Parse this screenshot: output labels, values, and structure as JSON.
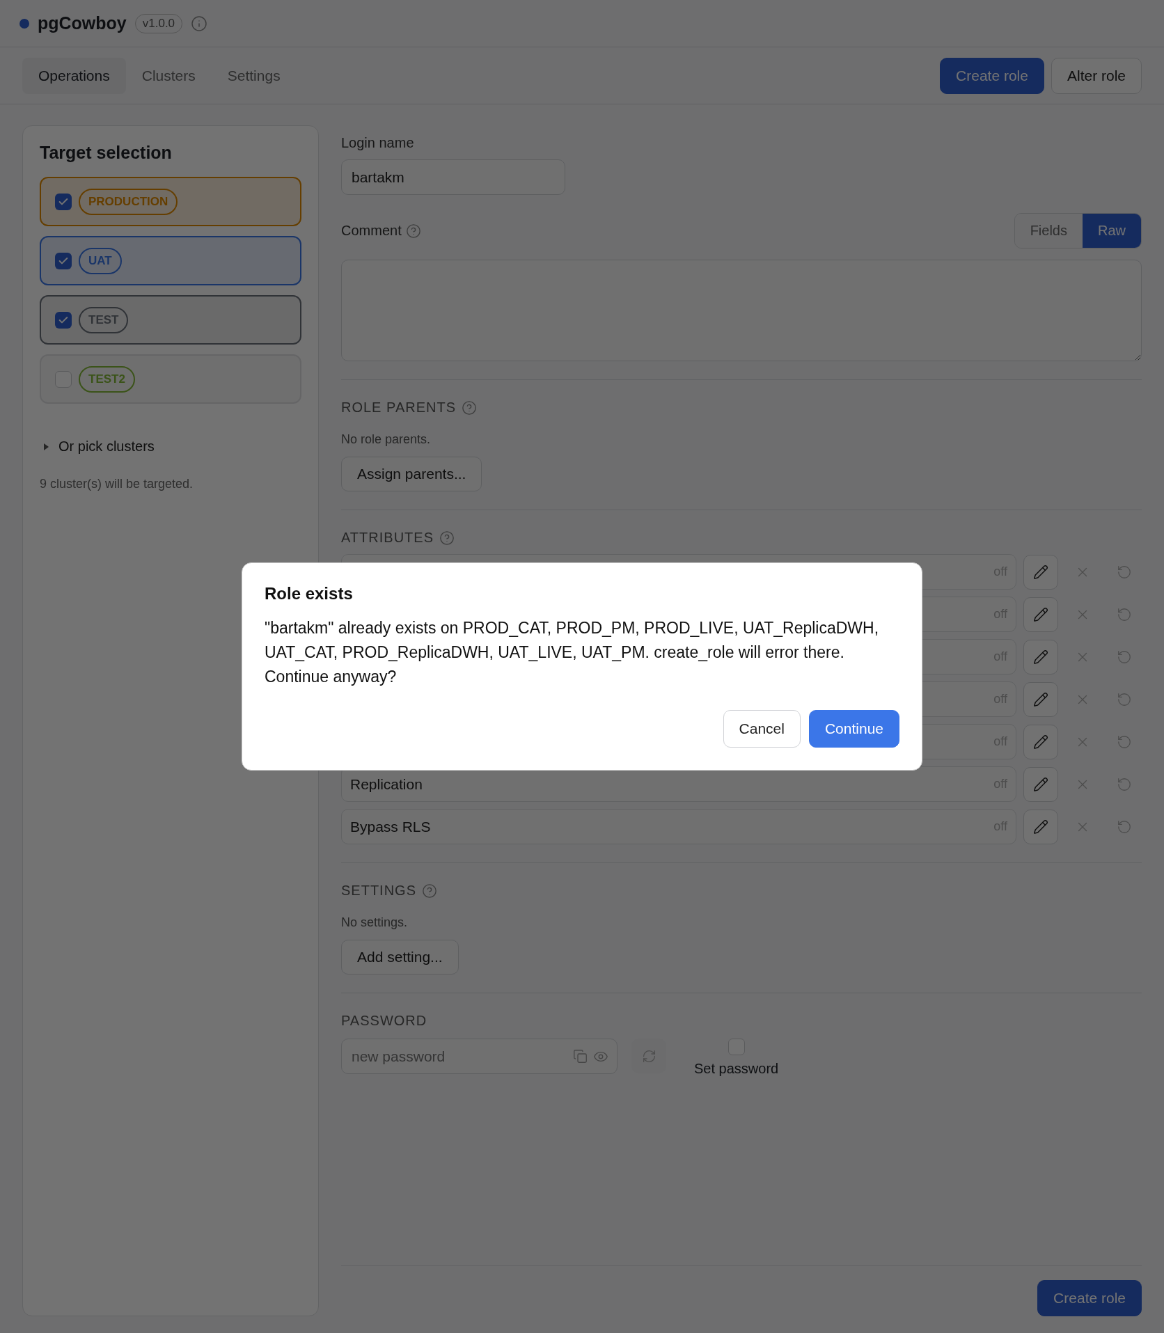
{
  "app": {
    "name": "pgCowboy",
    "version": "v1.0.0"
  },
  "nav_tabs": [
    {
      "label": "Operations",
      "selected": true
    },
    {
      "label": "Clusters",
      "selected": false
    },
    {
      "label": "Settings",
      "selected": false
    }
  ],
  "header_actions": [
    {
      "label": "Create role",
      "kind": "primary"
    },
    {
      "label": "Alter role",
      "kind": "secondary"
    }
  ],
  "target_selection": {
    "title": "Target selection",
    "environments": [
      {
        "label": "PRODUCTION",
        "checked": true,
        "color": "#653e00"
      },
      {
        "label": "UAT",
        "checked": true,
        "color": "#1a3568"
      },
      {
        "label": "TEST",
        "checked": true,
        "color": "#303337"
      },
      {
        "label": "TEST2",
        "checked": false,
        "color": "#3b5319"
      }
    ],
    "pick_clusters": {
      "label": "Or pick clusters",
      "expanded": false
    },
    "summary": "9 cluster(s) will be targeted."
  },
  "form": {
    "login_name": {
      "label": "Login name",
      "value": "bartakm"
    },
    "comment": {
      "label": "Comment",
      "modes": [
        {
          "label": "Fields",
          "selected": false
        },
        {
          "label": "Raw",
          "selected": true
        }
      ]
    },
    "role_parents": {
      "heading": "ROLE PARENTS",
      "empty_text": "No role parents.",
      "button": "Assign parents..."
    },
    "attributes": {
      "heading": "ATTRIBUTES",
      "rows": [
        {
          "value": "off"
        },
        {
          "value": "off"
        },
        {
          "value": "off"
        },
        {
          "value": "off"
        },
        {
          "value": "off"
        },
        {
          "label": "Replication",
          "value": "off"
        },
        {
          "label": "Bypass RLS",
          "value": "off"
        }
      ]
    },
    "settings": {
      "heading": "SETTINGS",
      "empty_text": "No settings.",
      "button": "Add setting..."
    },
    "password": {
      "heading": "PASSWORD",
      "placeholder": "new password",
      "set_password": {
        "label": "Set password",
        "checked": false
      }
    },
    "submit": "Create role"
  },
  "dialog": {
    "title": "Role exists",
    "message": "\"bartakm\" already exists on PROD_CAT, PROD_PM, PROD_LIVE, UAT_ReplicaDWH, UAT_CAT, PROD_ReplicaDWH, UAT_LIVE, UAT_PM. create_role will error there. Continue anyway?",
    "buttons": [
      {
        "label": "Cancel",
        "kind": "secondary"
      },
      {
        "label": "Continue",
        "kind": "primary"
      }
    ]
  }
}
